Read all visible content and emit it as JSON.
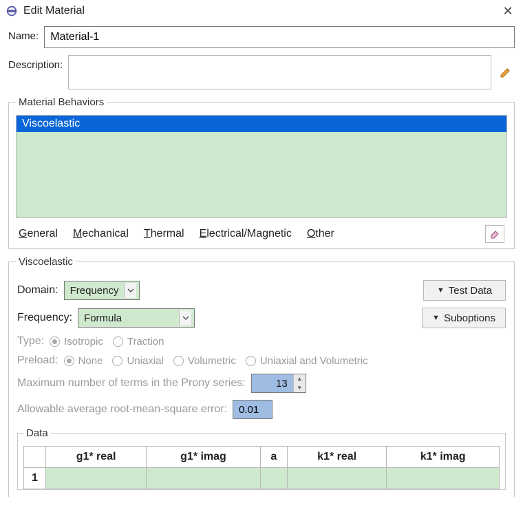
{
  "window": {
    "title": "Edit Material",
    "close_glyph": "✕"
  },
  "name_row": {
    "label": "Name:",
    "value": "Material-1"
  },
  "description_row": {
    "label": "Description:",
    "value": ""
  },
  "behaviors": {
    "legend": "Material Behaviors",
    "items": [
      {
        "label": "Viscoelastic",
        "selected": true
      }
    ],
    "menus": {
      "general": "General",
      "mechanical": "Mechanical",
      "thermal": "Thermal",
      "electrical": "Electrical/Magnetic",
      "other": "Other"
    }
  },
  "visco": {
    "legend": "Viscoelastic",
    "domain_label": "Domain:",
    "domain_value": "Frequency",
    "frequency_label": "Frequency:",
    "frequency_value": "Formula",
    "test_data_btn": "Test Data",
    "suboptions_btn": "Suboptions",
    "type_label": "Type:",
    "type_options": [
      "Isotropic",
      "Traction"
    ],
    "type_selected": 0,
    "preload_label": "Preload:",
    "preload_options": [
      "None",
      "Uniaxial",
      "Volumetric",
      "Uniaxial and Volumetric"
    ],
    "preload_selected": 0,
    "prony_label": "Maximum number of terms in the Prony series:",
    "prony_value": "13",
    "rmse_label": "Allowable average root-mean-square error:",
    "rmse_value": "0.01"
  },
  "data": {
    "legend": "Data",
    "columns": [
      "g1* real",
      "g1* imag",
      "a",
      "k1* real",
      "k1* imag"
    ],
    "rows": [
      {
        "num": "1",
        "cells": [
          "",
          "",
          "",
          "",
          ""
        ]
      }
    ]
  }
}
